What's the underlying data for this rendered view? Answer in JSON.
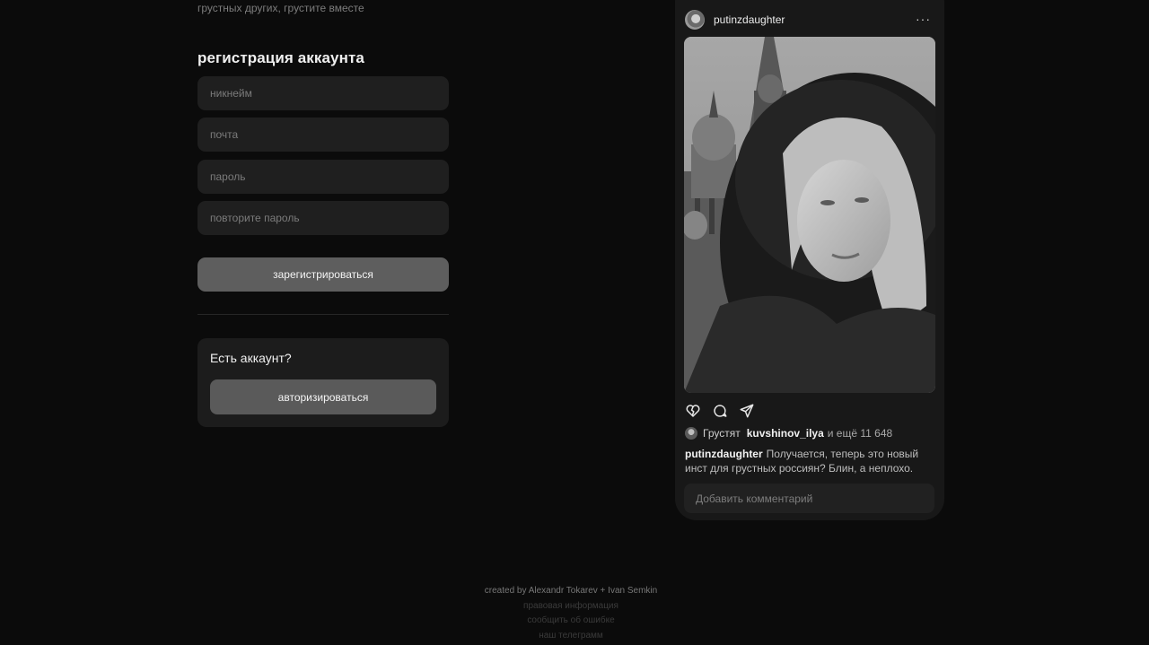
{
  "header": {
    "tagline": "грустных других, грустите вместе"
  },
  "register": {
    "title": "регистрация аккаунта",
    "nickname_placeholder": "никнейм",
    "email_placeholder": "почта",
    "password_placeholder": "пароль",
    "repeat_password_placeholder": "повторите пароль",
    "submit_label": "зарегистрироваться"
  },
  "login": {
    "question": "Есть аккаунт?",
    "button_label": "авторизироваться"
  },
  "post": {
    "username": "putinzdaughter",
    "more_icon": "···",
    "icons": [
      "broken-heart-icon",
      "comment-icon",
      "send-icon"
    ],
    "likes_label": "Грустят",
    "likes_user": "kuvshinov_ilya",
    "likes_rest": "и ещё 11 648",
    "caption_user": "putinzdaughter",
    "caption_text": "Получается, теперь это новый инст для грустных россиян? Блин, а неплохо.",
    "comment_placeholder": "Добавить комментарий"
  },
  "footer": {
    "credit": "created by Alexandr Tokarev + Ivan Semkin",
    "legal_link": "правовая информация",
    "report_link": "сообщить об ошибке",
    "telegram_link": "наш телеграмм"
  },
  "colors": {
    "background": "#0b0b0b",
    "field": "#1f1f1f",
    "primary_button": "#5e5e5e",
    "card": "#181818"
  }
}
